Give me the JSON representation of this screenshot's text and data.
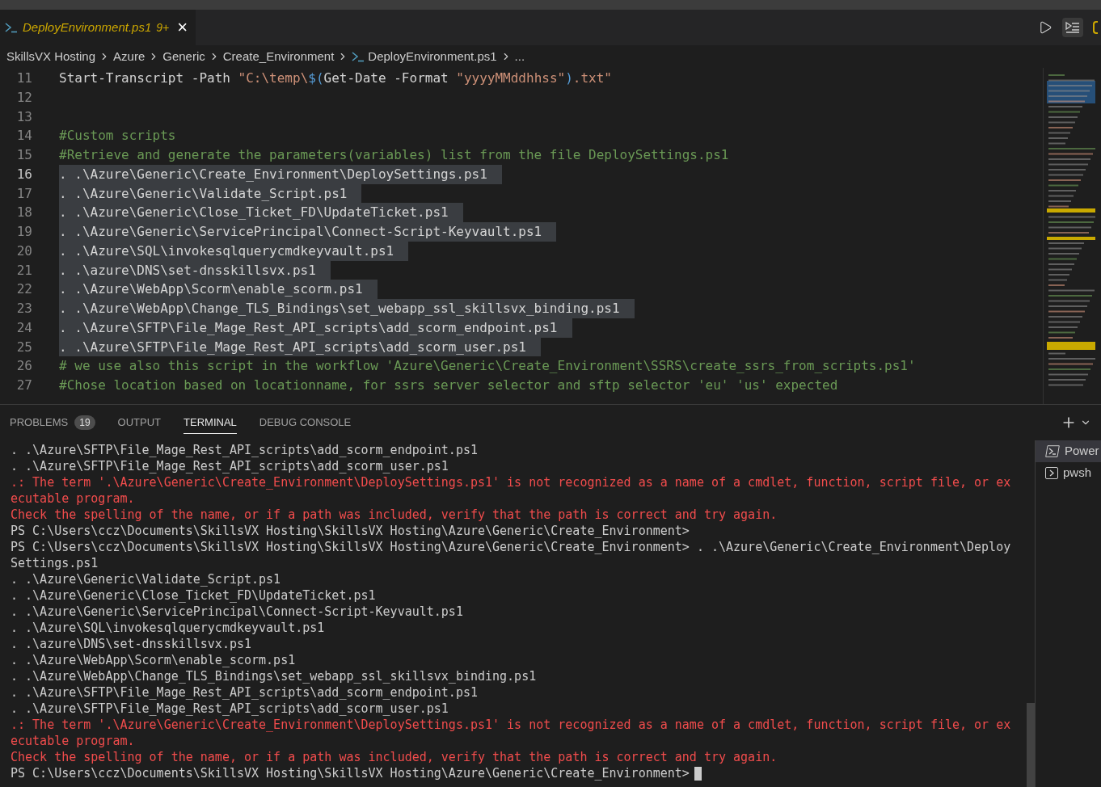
{
  "tab": {
    "title": "DeployEnvironment.ps1",
    "problems": "9+",
    "close": "×",
    "selected": true
  },
  "breadcrumbs": [
    {
      "label": "SkillsVX Hosting",
      "kind": "folder"
    },
    {
      "label": "Azure",
      "kind": "folder"
    },
    {
      "label": "Generic",
      "kind": "folder"
    },
    {
      "label": "Create_Environment",
      "kind": "folder"
    },
    {
      "label": "DeployEnvironment.ps1",
      "kind": "file"
    },
    {
      "label": "...",
      "kind": "symbol"
    }
  ],
  "editor": {
    "lines": [
      {
        "number": "11",
        "selected": false,
        "current": false,
        "tokens": [
          {
            "text": "Start-Transcript -Path ",
            "kind": "plain"
          },
          {
            "text": "\"C:\\temp\\",
            "kind": "string"
          },
          {
            "text": "$(",
            "kind": "variable"
          },
          {
            "text": "Get-Date -Format ",
            "kind": "plain"
          },
          {
            "text": "\"yyyyMMddhhss\"",
            "kind": "string"
          },
          {
            "text": ")",
            "kind": "variable"
          },
          {
            "text": ".txt\"",
            "kind": "string"
          }
        ]
      },
      {
        "number": "12",
        "selected": false,
        "current": false
      },
      {
        "number": "13",
        "selected": false,
        "current": false
      },
      {
        "number": "14",
        "selected": false,
        "current": false,
        "tokens": [
          {
            "text": "#Custom scripts",
            "kind": "comment"
          }
        ]
      },
      {
        "number": "15",
        "selected": false,
        "current": false,
        "tokens": [
          {
            "text": "#Retrieve and generate the parameters(variables) list from the file DeploySettings.ps1",
            "kind": "comment"
          }
        ]
      },
      {
        "number": "16",
        "selected": true,
        "current": true,
        "tokens": [
          {
            "text": ". .\\Azure\\Generic\\Create_Environment\\DeploySettings.ps1",
            "kind": "plain"
          }
        ]
      },
      {
        "number": "17",
        "selected": true,
        "current": false,
        "tokens": [
          {
            "text": ". .\\Azure\\Generic\\Validate_Script.ps1",
            "kind": "plain"
          }
        ]
      },
      {
        "number": "18",
        "selected": true,
        "current": false,
        "tokens": [
          {
            "text": ". .\\Azure\\Generic\\Close_Ticket_FD\\UpdateTicket.ps1",
            "kind": "plain"
          }
        ]
      },
      {
        "number": "19",
        "selected": true,
        "current": false,
        "tokens": [
          {
            "text": ". .\\Azure\\Generic\\ServicePrincipal\\Connect-Script-Keyvault.ps1",
            "kind": "plain"
          }
        ]
      },
      {
        "number": "20",
        "selected": true,
        "current": false,
        "tokens": [
          {
            "text": ". .\\Azure\\SQL\\invokesqlquerycmdkeyvault.ps1",
            "kind": "plain"
          }
        ]
      },
      {
        "number": "21",
        "selected": true,
        "current": false,
        "tokens": [
          {
            "text": ". .\\azure\\DNS\\set-dnsskillsvx.ps1",
            "kind": "plain"
          }
        ]
      },
      {
        "number": "22",
        "selected": true,
        "current": false,
        "tokens": [
          {
            "text": ". .\\Azure\\WebApp\\Scorm\\enable_scorm.ps1",
            "kind": "plain"
          }
        ]
      },
      {
        "number": "23",
        "selected": true,
        "current": false,
        "tokens": [
          {
            "text": ". .\\Azure\\WebApp\\Change_TLS_Bindings\\set_webapp_ssl_skillsvx_binding.ps1",
            "kind": "plain"
          }
        ]
      },
      {
        "number": "24",
        "selected": true,
        "current": false,
        "tokens": [
          {
            "text": ". .\\Azure\\SFTP\\File_Mage_Rest_API_scripts\\add_scorm_endpoint.ps1",
            "kind": "plain"
          }
        ]
      },
      {
        "number": "25",
        "selected": true,
        "current": false,
        "tokens": [
          {
            "text": ". .\\Azure\\SFTP\\File_Mage_Rest_API_scripts\\add_scorm_user.ps1",
            "kind": "plain"
          }
        ]
      },
      {
        "number": "26",
        "selected": false,
        "current": false,
        "tokens": [
          {
            "text": "# we use also this script in the workflow 'Azure\\Generic\\Create_Environment\\SSRS\\create_ssrs_from_scripts.ps1'",
            "kind": "comment"
          }
        ]
      },
      {
        "number": "27",
        "selected": false,
        "current": false,
        "tokens": [
          {
            "text": "#Chose location based on locationname, for ssrs server selector and sftp selector 'eu' 'us' expected",
            "kind": "comment"
          }
        ]
      }
    ]
  },
  "panel": {
    "tabs": [
      {
        "label": "PROBLEMS",
        "badge": "19",
        "selected": false
      },
      {
        "label": "OUTPUT",
        "selected": false
      },
      {
        "label": "TERMINAL",
        "selected": true
      },
      {
        "label": "DEBUG CONSOLE",
        "selected": false
      }
    ]
  },
  "terminal": {
    "cursor_visible": true,
    "lines": [
      {
        "kind": "normal",
        "text": ". .\\Azure\\SFTP\\File_Mage_Rest_API_scripts\\add_scorm_endpoint.ps1"
      },
      {
        "kind": "normal",
        "text": ". .\\Azure\\SFTP\\File_Mage_Rest_API_scripts\\add_scorm_user.ps1"
      },
      {
        "kind": "error",
        "text": ".: The term '.\\Azure\\Generic\\Create_Environment\\DeploySettings.ps1' is not recognized as a name of a cmdlet, function, script file, or ex"
      },
      {
        "kind": "error",
        "text": "ecutable program."
      },
      {
        "kind": "error",
        "text": "Check the spelling of the name, or if a path was included, verify that the path is correct and try again."
      },
      {
        "kind": "normal",
        "text": "PS C:\\Users\\ccz\\Documents\\SkillsVX Hosting\\SkillsVX Hosting\\Azure\\Generic\\Create_Environment>"
      },
      {
        "kind": "normal",
        "text": "PS C:\\Users\\ccz\\Documents\\SkillsVX Hosting\\SkillsVX Hosting\\Azure\\Generic\\Create_Environment> . .\\Azure\\Generic\\Create_Environment\\Deploy"
      },
      {
        "kind": "normal",
        "text": "Settings.ps1"
      },
      {
        "kind": "normal",
        "text": ". .\\Azure\\Generic\\Validate_Script.ps1"
      },
      {
        "kind": "normal",
        "text": ". .\\Azure\\Generic\\Close_Ticket_FD\\UpdateTicket.ps1"
      },
      {
        "kind": "normal",
        "text": ". .\\Azure\\Generic\\ServicePrincipal\\Connect-Script-Keyvault.ps1"
      },
      {
        "kind": "normal",
        "text": ". .\\Azure\\SQL\\invokesqlquerycmdkeyvault.ps1"
      },
      {
        "kind": "normal",
        "text": ". .\\azure\\DNS\\set-dnsskillsvx.ps1"
      },
      {
        "kind": "normal",
        "text": ". .\\Azure\\WebApp\\Scorm\\enable_scorm.ps1"
      },
      {
        "kind": "normal",
        "text": ". .\\Azure\\WebApp\\Change_TLS_Bindings\\set_webapp_ssl_skillsvx_binding.ps1"
      },
      {
        "kind": "normal",
        "text": ". .\\Azure\\SFTP\\File_Mage_Rest_API_scripts\\add_scorm_endpoint.ps1"
      },
      {
        "kind": "normal",
        "text": ". .\\Azure\\SFTP\\File_Mage_Rest_API_scripts\\add_scorm_user.ps1"
      },
      {
        "kind": "error",
        "text": ".: The term '.\\Azure\\Generic\\Create_Environment\\DeploySettings.ps1' is not recognized as a name of a cmdlet, function, script file, or ex"
      },
      {
        "kind": "error",
        "text": "ecutable program."
      },
      {
        "kind": "error",
        "text": "Check the spelling of the name, or if a path was included, verify that the path is correct and try again."
      },
      {
        "kind": "normal",
        "text": "PS C:\\Users\\ccz\\Documents\\SkillsVX Hosting\\SkillsVX Hosting\\Azure\\Generic\\Create_Environment>"
      }
    ]
  },
  "terminal_list": [
    {
      "label": "Power",
      "kind": "powershell",
      "selected": true
    },
    {
      "label": "pwsh",
      "kind": "shell",
      "selected": false
    }
  ]
}
